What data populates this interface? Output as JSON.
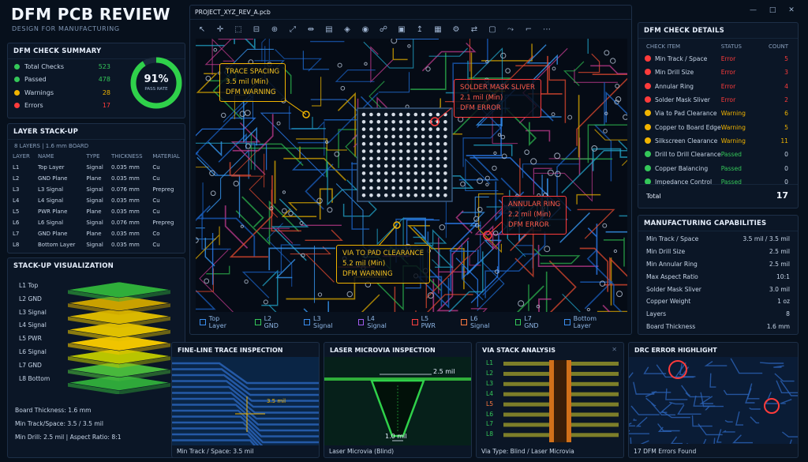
{
  "header": {
    "title": "DFM PCB REVIEW",
    "subtitle": "DESIGN FOR MANUFACTURING"
  },
  "summary": {
    "title": "DFM CHECK SUMMARY",
    "rows": [
      {
        "label": "Total Checks",
        "value": "523",
        "color": "#34c759"
      },
      {
        "label": "Passed",
        "value": "478",
        "color": "#34c759"
      },
      {
        "label": "Warnings",
        "value": "28",
        "color": "#f1b400"
      },
      {
        "label": "Errors",
        "value": "17",
        "color": "#ff3b3b"
      }
    ],
    "pass_rate": "91%",
    "pass_rate_label": "PASS RATE",
    "pass_fraction": 0.91
  },
  "layer_stack": {
    "title": "LAYER STACK-UP",
    "subtitle": "8 LAYERS | 1.6 mm BOARD",
    "headers": [
      "LAYER",
      "NAME",
      "TYPE",
      "THICKNESS",
      "MATERIAL"
    ],
    "rows": [
      [
        "L1",
        "Top Layer",
        "Signal",
        "0.035 mm",
        "Cu"
      ],
      [
        "L2",
        "GND Plane",
        "Plane",
        "0.035 mm",
        "Cu"
      ],
      [
        "L3",
        "L3 Signal",
        "Signal",
        "0.076 mm",
        "Prepreg"
      ],
      [
        "L4",
        "L4 Signal",
        "Signal",
        "0.035 mm",
        "Cu"
      ],
      [
        "L5",
        "PWR Plane",
        "Plane",
        "0.035 mm",
        "Cu"
      ],
      [
        "L6",
        "L6 Signal",
        "Signal",
        "0.076 mm",
        "Prepreg"
      ],
      [
        "L7",
        "GND Plane",
        "Plane",
        "0.035 mm",
        "Co"
      ],
      [
        "L8",
        "Bottom Layer",
        "Signal",
        "0.035 mm",
        "Cu"
      ]
    ]
  },
  "stack_viz": {
    "title": "STACK-UP VISUALIZATION",
    "labels": [
      "L1 Top",
      "L2 GND",
      "L3 Signal",
      "L4 Signal",
      "L5 PWR",
      "L6 Signal",
      "L7 GND",
      "L8 Bottom"
    ],
    "colors": [
      "#2fae3a",
      "#c9a100",
      "#d9b800",
      "#e0c000",
      "#f0c400",
      "#b9c400",
      "#48b83c",
      "#2fa83a"
    ],
    "notes": [
      "Board Thickness: 1.6 mm",
      "Min Track/Space: 3.5 / 3.5 mil",
      "Min Drill: 2.5 mil | Aspect Ratio: 8:1"
    ]
  },
  "viewer": {
    "file_tab": "PROJECT_XYZ_REV_A.pcb",
    "toolbar_icons": [
      "cursor-icon",
      "pan-icon",
      "zoom-area-icon",
      "zoom-out-icon",
      "zoom-in-icon",
      "zoom-fit-icon",
      "measure-icon",
      "layers-icon",
      "drc-icon",
      "highlight-icon",
      "net-icon",
      "3d-icon",
      "export-icon",
      "grid-icon",
      "settings-icon",
      "flip-icon",
      "snapshot-icon",
      "route-icon",
      "ruler-icon",
      "more-icon"
    ],
    "callouts": [
      {
        "kind": "warn",
        "lines": [
          "TRACE SPACING",
          "3.5 mil (Min)",
          "DFM WARNING"
        ]
      },
      {
        "kind": "err",
        "lines": [
          "SOLDER MASK SLIVER",
          "2.1 mil (Min)",
          "DFM ERROR"
        ]
      },
      {
        "kind": "err",
        "lines": [
          "ANNULAR RING",
          "2.2 mil (Min)",
          "DFM ERROR"
        ]
      },
      {
        "kind": "warn",
        "lines": [
          "VIA TO PAD CLEARANCE",
          "5.2 mil (Min)",
          "DFM WARNING"
        ]
      }
    ],
    "layer_tabs": [
      {
        "label": "Top Layer",
        "color": "#3a8ef0"
      },
      {
        "label": "L2 GND",
        "color": "#34c759"
      },
      {
        "label": "L3 Signal",
        "color": "#3a8ef0"
      },
      {
        "label": "L4 Signal",
        "color": "#a25cf0"
      },
      {
        "label": "L5 PWR",
        "color": "#ff4040"
      },
      {
        "label": "L6 Signal",
        "color": "#ff7a40"
      },
      {
        "label": "L7 GND",
        "color": "#34c759"
      },
      {
        "label": "Bottom Layer",
        "color": "#3a8ef0"
      }
    ]
  },
  "check_details": {
    "title": "DFM CHECK DETAILS",
    "headers": [
      "CHECK ITEM",
      "STATUS",
      "COUNT"
    ],
    "rows": [
      {
        "item": "Min Track / Space",
        "status": "Error",
        "count": "5"
      },
      {
        "item": "Min Drill Size",
        "status": "Error",
        "count": "3"
      },
      {
        "item": "Annular Ring",
        "status": "Error",
        "count": "4"
      },
      {
        "item": "Solder Mask Sliver",
        "status": "Error",
        "count": "2"
      },
      {
        "item": "Via to Pad Clearance",
        "status": "Warning",
        "count": "6"
      },
      {
        "item": "Copper to Board Edge",
        "status": "Warning",
        "count": "5"
      },
      {
        "item": "Silkscreen Clearance",
        "status": "Warning",
        "count": "11"
      },
      {
        "item": "Drill to Drill Clearance",
        "status": "Passed",
        "count": "0"
      },
      {
        "item": "Copper Balancing",
        "status": "Passed",
        "count": "0"
      },
      {
        "item": "Impedance Control",
        "status": "Passed",
        "count": "0"
      }
    ],
    "total_label": "Total",
    "total_value": "17",
    "colors": {
      "Error": "#ff3b3b",
      "Warning": "#f1b400",
      "Passed": "#34c759"
    }
  },
  "capabilities": {
    "title": "MANUFACTURING CAPABILITIES",
    "rows": [
      {
        "k": "Min Track / Space",
        "v": "3.5 mil / 3.5 mil"
      },
      {
        "k": "Min Drill Size",
        "v": "2.5 mil"
      },
      {
        "k": "Min Annular Ring",
        "v": "2.5 mil"
      },
      {
        "k": "Max Aspect Ratio",
        "v": "10:1"
      },
      {
        "k": "Solder Mask Sliver",
        "v": "3.0 mil"
      },
      {
        "k": "Copper Weight",
        "v": "1 oz"
      },
      {
        "k": "Layers",
        "v": "8"
      },
      {
        "k": "Board Thickness",
        "v": "1.6 mm"
      }
    ]
  },
  "inspections": [
    {
      "title": "FINE-LINE TRACE INSPECTION",
      "caption": "Min Track / Space: 3.5 mil",
      "note": "3.5 mil"
    },
    {
      "title": "LASER MICROVIA INSPECTION",
      "caption": "Laser Microvia (Blind)",
      "top": "2.5 mil",
      "bottom": "1.0 mil"
    },
    {
      "title": "VIA STACK ANALYSIS",
      "caption": "Via Type: Blind / Laser Microvia",
      "layers": [
        "L1",
        "L2",
        "L3",
        "L4",
        "L5",
        "L6",
        "L7",
        "L8"
      ]
    },
    {
      "title": "DRC ERROR HIGHLIGHT",
      "caption": "17 DFM Errors Found"
    }
  ]
}
